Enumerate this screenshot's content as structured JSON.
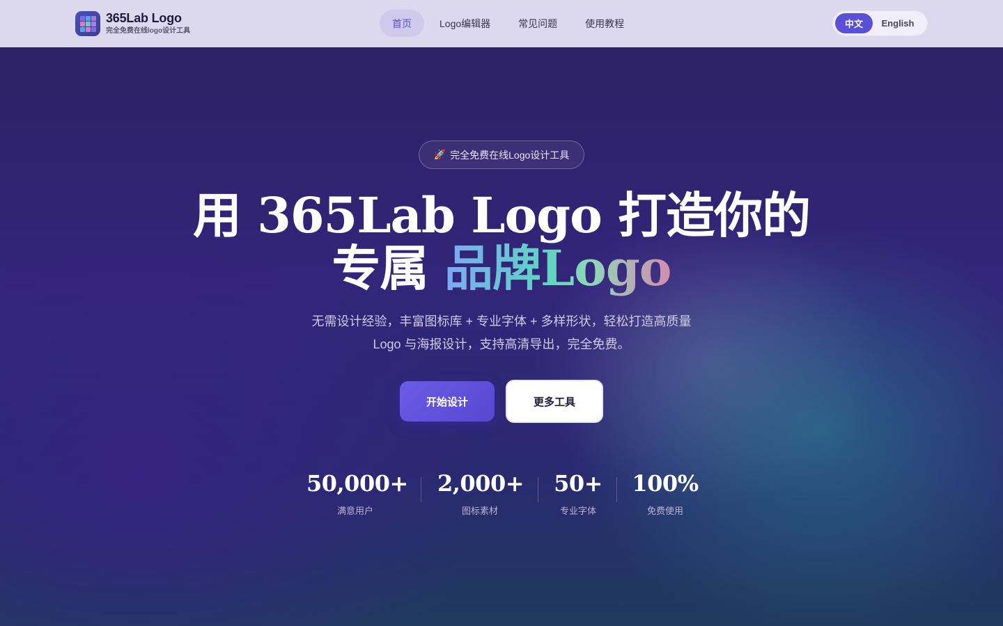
{
  "header": {
    "brand_title": "365Lab Logo",
    "brand_subtitle": "完全免费在线logo设计工具",
    "nav": [
      {
        "label": "首页",
        "active": true
      },
      {
        "label": "Logo编辑器",
        "active": false
      },
      {
        "label": "常见问题",
        "active": false
      },
      {
        "label": "使用教程",
        "active": false
      }
    ],
    "lang_zh": "中文",
    "lang_en": "English",
    "lang_selected": "中文"
  },
  "hero": {
    "badge_icon": "🚀",
    "badge_text": "完全免费在线Logo设计工具",
    "headline_line1": "用 365Lab Logo 打造你的",
    "headline_line2_plain": "专属 ",
    "headline_line2_highlight": "品牌Logo",
    "subtitle_line1": "无需设计经验，丰富图标库 + 专业字体 + 多样形状，轻松打造高质量",
    "subtitle_line2": "Logo 与海报设计，支持高清导出，完全免费。",
    "primary_button": "开始设计",
    "secondary_button": "更多工具"
  },
  "stats": [
    {
      "value": "50,000+",
      "label": "满意用户"
    },
    {
      "value": "2,000+",
      "label": "图标素材"
    },
    {
      "value": "50+",
      "label": "专业字体"
    },
    {
      "value": "100%",
      "label": "免费使用"
    }
  ],
  "colors": {
    "accent": "#5b4fd6",
    "header_bg": "#dcd8ee",
    "hero_bg": "#2b2160"
  },
  "icons": {
    "brand": "grid-logo-icon",
    "badge": "rocket-icon"
  }
}
